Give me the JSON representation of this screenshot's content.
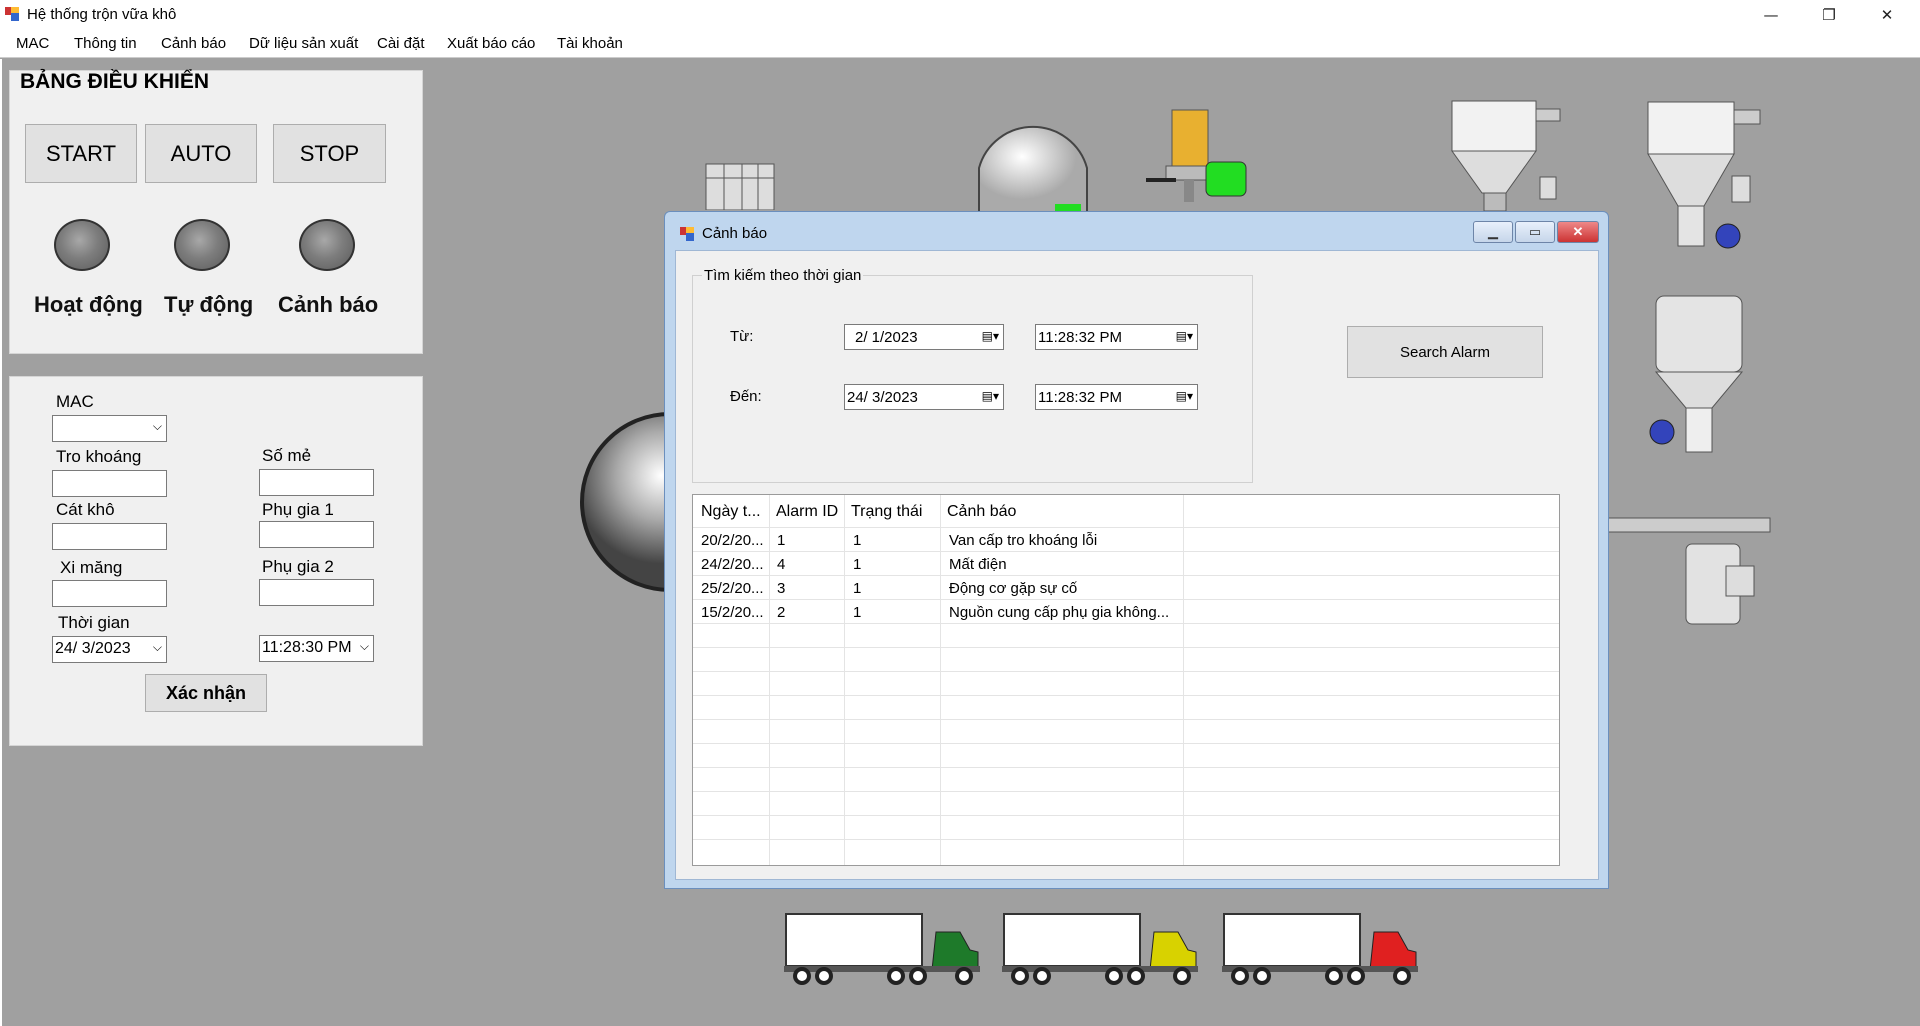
{
  "window": {
    "title": "Hệ thống trộn vữa khô",
    "minimize": "—",
    "restore": "❐",
    "close": "✕"
  },
  "menu": [
    "MAC",
    "Thông tin",
    "Cảnh báo",
    "Dữ liệu sản xuất",
    "Cài đặt",
    "Xuất báo cáo",
    "Tài khoản"
  ],
  "control_panel": {
    "title": "BẢNG ĐIỀU KHIỂN",
    "start": "START",
    "auto": "AUTO",
    "stop": "STOP",
    "lamps": [
      "Hoạt động",
      "Tự động",
      "Cảnh báo"
    ]
  },
  "input_panel": {
    "mac_label": "MAC",
    "mac_value": "",
    "tro_khoang": "Tro khoáng",
    "so_me": "Số mẻ",
    "cat_kho": "Cát khô",
    "phu_gia_1": "Phụ gia 1",
    "xi_mang": "Xi măng",
    "phu_gia_2": "Phụ gia 2",
    "thoi_gian": "Thời gian",
    "date_value": "24/  3/2023",
    "time_value": "11:28:30 PM",
    "confirm": "Xác nhận"
  },
  "dialog": {
    "title": "Cảnh báo",
    "group_title": "Tìm kiếm theo thời gian",
    "from_label": "Từ:",
    "to_label": "Đến:",
    "from_date": "2/  1/2023",
    "from_time": "11:28:32 PM",
    "to_date": "24/  3/2023",
    "to_time": "11:28:32 PM",
    "search_button": "Search Alarm",
    "columns": [
      "Ngày t...",
      "Alarm ID",
      "Trạng thái",
      "Cảnh báo"
    ],
    "rows": [
      [
        "20/2/20...",
        "1",
        "1",
        "Van cấp tro khoáng lỗi"
      ],
      [
        "24/2/20...",
        "4",
        "1",
        "Mất điện"
      ],
      [
        "25/2/20...",
        "3",
        "1",
        "Động cơ gặp sự cố"
      ],
      [
        "15/2/20...",
        "2",
        "1",
        "Nguồn cung cấp phụ gia không..."
      ]
    ]
  },
  "colors": {
    "background": "#a0a0a0",
    "panel": "#f0f0f0",
    "dialog_frame": "#bfd6ee",
    "close_button": "#d9534f",
    "motor_green": "#22dd22",
    "truck_green": "#1e7a2a",
    "truck_yellow": "#d8d200",
    "truck_red": "#e02020"
  }
}
